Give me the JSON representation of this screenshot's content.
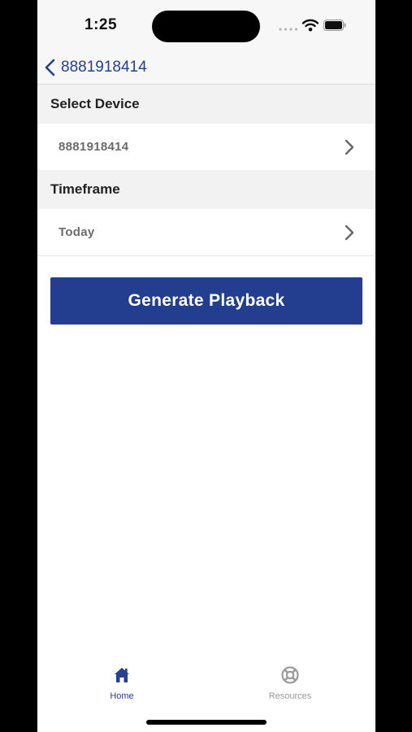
{
  "status_bar": {
    "time": "1:25"
  },
  "nav": {
    "back_label": "8881918414",
    "back_icon": "chevron-left-icon"
  },
  "sections": {
    "device": {
      "header": "Select Device",
      "value": "8881918414"
    },
    "timeframe": {
      "header": "Timeframe",
      "value": "Today"
    }
  },
  "actions": {
    "generate_label": "Generate Playback"
  },
  "tab_bar": {
    "tabs": [
      {
        "label": "Home",
        "icon": "home-icon",
        "active": true
      },
      {
        "label": "Resources",
        "icon": "lifebuoy-icon",
        "active": false
      }
    ]
  },
  "colors": {
    "brand": "#243e8f",
    "inactive_tab": "#9a9a9a",
    "section_bg": "#f2f2f2"
  }
}
